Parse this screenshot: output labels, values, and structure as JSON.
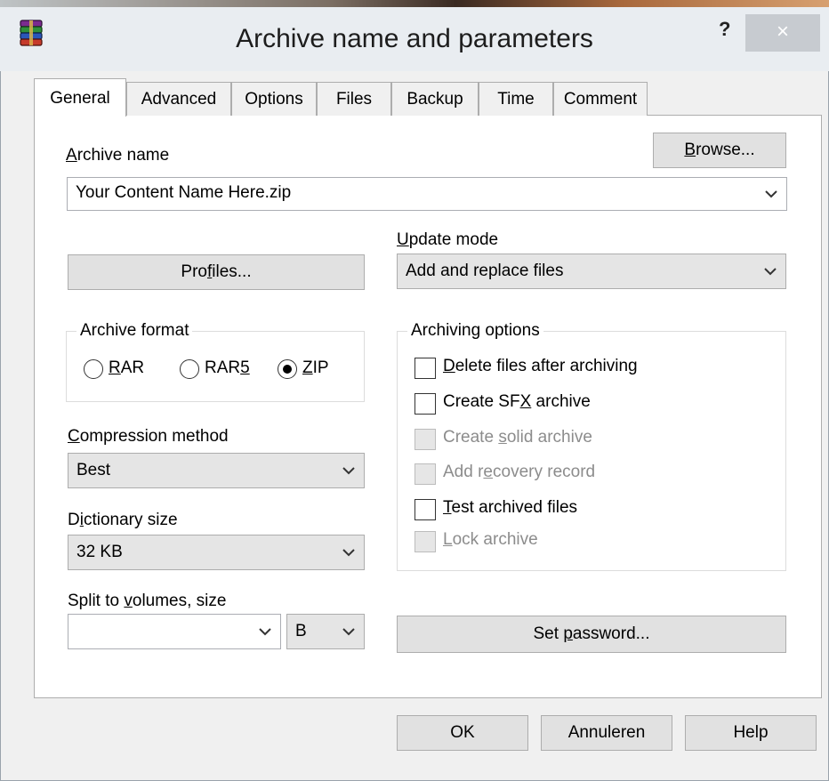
{
  "window": {
    "title": "Archive name and parameters",
    "help_label": "?",
    "close_label": "×"
  },
  "tabs": [
    "General",
    "Advanced",
    "Options",
    "Files",
    "Backup",
    "Time",
    "Comment"
  ],
  "active_tab": "General",
  "archive_name": {
    "label": "Archive name",
    "value": "Your Content Name Here.zip",
    "browse_label": "Browse..."
  },
  "update_mode": {
    "label": "Update mode",
    "value": "Add and replace files"
  },
  "profiles_label": "Profiles...",
  "archive_format": {
    "title": "Archive format",
    "options": [
      "RAR",
      "RAR5",
      "ZIP"
    ],
    "selected": "ZIP"
  },
  "archiving_options": {
    "title": "Archiving options",
    "items": [
      {
        "label": "Delete files after archiving",
        "checked": false,
        "enabled": true
      },
      {
        "label": "Create SFX archive",
        "checked": false,
        "enabled": true
      },
      {
        "label": "Create solid archive",
        "checked": false,
        "enabled": false
      },
      {
        "label": "Add recovery record",
        "checked": false,
        "enabled": false
      },
      {
        "label": "Test archived files",
        "checked": false,
        "enabled": true
      },
      {
        "label": "Lock archive",
        "checked": false,
        "enabled": false
      }
    ]
  },
  "compression_method": {
    "label": "Compression method",
    "value": "Best"
  },
  "dictionary_size": {
    "label": "Dictionary size",
    "value": "32 KB"
  },
  "split_volumes": {
    "label": "Split to volumes, size",
    "value": "",
    "unit": "B"
  },
  "set_password_label": "Set password...",
  "footer": {
    "ok_label": "OK",
    "cancel_label": "Annuleren",
    "help_label": "Help"
  },
  "colors": {
    "close_button": "#c7cbd0",
    "titlebar": "#e9edf1",
    "panel": "#ffffff",
    "dialog": "#f0f0f0",
    "disabled_text": "#8c8c8c"
  }
}
